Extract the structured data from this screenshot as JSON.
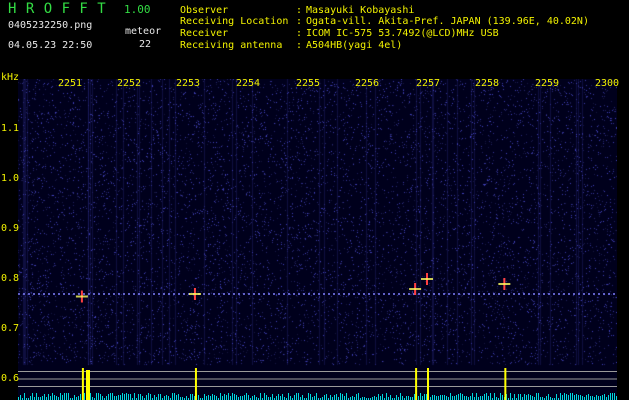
{
  "header": {
    "app_title": "H R O F F T",
    "version": "1.00",
    "filename": "0405232250.png",
    "datetime": "04.05.23 22:50",
    "meteor_label": "meteor",
    "meteor_count": "22"
  },
  "info": [
    {
      "key": "Observer",
      "value": "Masayuki Kobayashi"
    },
    {
      "key": "Receiving Location",
      "value": "Ogata-vill. Akita-Pref. JAPAN (139.96E, 40.02N)"
    },
    {
      "key": "Receiver",
      "value": "ICOM IC-575 53.7492(@LCD)MHz USB"
    },
    {
      "key": "Receiving antenna",
      "value": "A504HB(yagi 4el)"
    }
  ],
  "colon": ":",
  "chart_data": {
    "type": "heatmap",
    "ylabel": "kHz",
    "x_ticks": [
      "2251",
      "2252",
      "2253",
      "2254",
      "2255",
      "2256",
      "2257",
      "2258",
      "2259",
      "2300"
    ],
    "y_ticks": [
      "1.1",
      "1.0",
      "0.9",
      "0.8",
      "0.7",
      "0.6"
    ],
    "ylim": [
      0.58,
      1.18
    ],
    "carrier_freq_khz": 0.77,
    "meteor_events": [
      {
        "time": "22:51.2",
        "freq_khz": 0.765
      },
      {
        "time": "22:53.1",
        "freq_khz": 0.77
      },
      {
        "time": "22:56.8",
        "freq_khz": 0.78
      },
      {
        "time": "22:57.0",
        "freq_khz": 0.8
      },
      {
        "time": "22:58.3",
        "freq_khz": 0.79
      }
    ],
    "colors": {
      "background": "#00001c",
      "carrier": "#7f7fff",
      "level": "#00ffff",
      "peak": "#ffff00",
      "ticks": "#f2f200",
      "header_green": "#33dd44"
    }
  }
}
